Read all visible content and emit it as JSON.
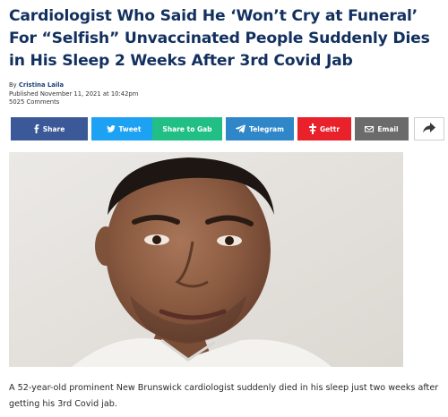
{
  "article": {
    "headline": "Cardiologist Who Said He ‘Won’t Cry at Funeral’ For “Selfish” Unvaccinated People Suddenly Dies in His Sleep 2 Weeks After 3rd Covid Jab",
    "byline": {
      "prefix": "By ",
      "author": "Cristina Laila",
      "published": "Published November 11, 2021 at 10:42pm",
      "comments": "5025 Comments"
    },
    "share_buttons": {
      "facebook": "Share",
      "twitter": "Tweet",
      "gab": "Share to Gab",
      "telegram": "Telegram",
      "gettr": "Gettr",
      "email": "Email"
    },
    "icons": {
      "facebook": "facebook-icon",
      "twitter": "twitter-bird-icon",
      "telegram": "telegram-plane-icon",
      "gettr": "gettr-icon",
      "email": "email-icon",
      "more": "share-arrow-icon"
    },
    "image": {
      "kind": "photo",
      "subject": "portrait-photo"
    },
    "caption": "A 52-year-old prominent New Brunswick cardiologist suddenly died in his sleep just two weeks after getting his 3rd Covid jab."
  },
  "colors": {
    "headline": "#12305f",
    "facebook": "#3b5998",
    "twitter": "#1da1f2",
    "gab": "#21bf85",
    "telegram": "#2f87c9",
    "gettr": "#e8212a",
    "email": "#6b6b6b"
  }
}
